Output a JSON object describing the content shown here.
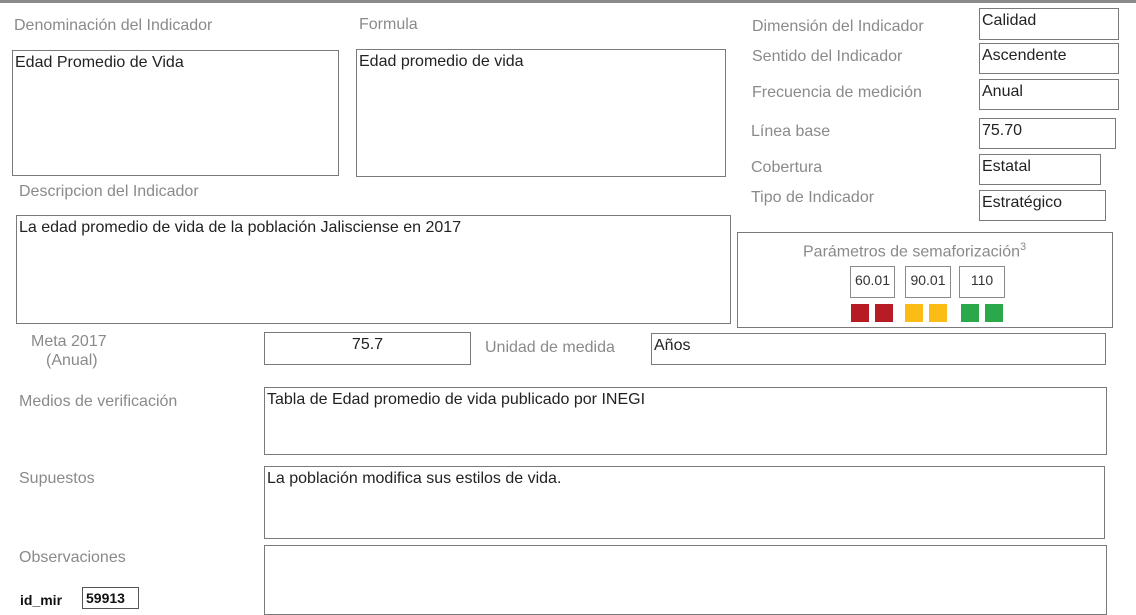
{
  "labels": {
    "denominacion": "Denominación del Indicador",
    "formula": "Formula",
    "descripcion": "Descripcion del Indicador",
    "dimension": "Dimensión del Indicador",
    "sentido": "Sentido del Indicador",
    "frecuencia": "Frecuencia de medición",
    "linea_base": "Línea base",
    "cobertura": "Cobertura",
    "tipo": "Tipo de Indicador",
    "meta_line1": "Meta 2017",
    "meta_line2": "(Anual)",
    "unidad": "Unidad de medida",
    "medios": "Medios de verificación",
    "supuestos": "Supuestos",
    "observaciones": "Observaciones",
    "id_mir": "id_mir"
  },
  "values": {
    "denominacion": "Edad Promedio de Vida",
    "formula": "Edad promedio de vida",
    "descripcion": "La edad promedio de vida de la población Jalisciense en 2017",
    "dimension": "Calidad",
    "sentido": "Ascendente",
    "frecuencia": "Anual",
    "linea_base": "75.70",
    "cobertura": "Estatal",
    "tipo": "Estratégico",
    "meta": "75.7",
    "unidad": "Años",
    "medios": "Tabla de Edad promedio de vida publicado por INEGI",
    "supuestos": "La población modifica sus estilos de vida.",
    "observaciones": "",
    "id_mir": "59913"
  },
  "semaforo": {
    "title": "Parámetros de semaforización",
    "footnote": "3",
    "thresholds": [
      "60.01",
      "90.01",
      "110"
    ],
    "colors": {
      "red": "#b71c24",
      "yellow": "#fbbc15",
      "green": "#2aa84a"
    }
  }
}
